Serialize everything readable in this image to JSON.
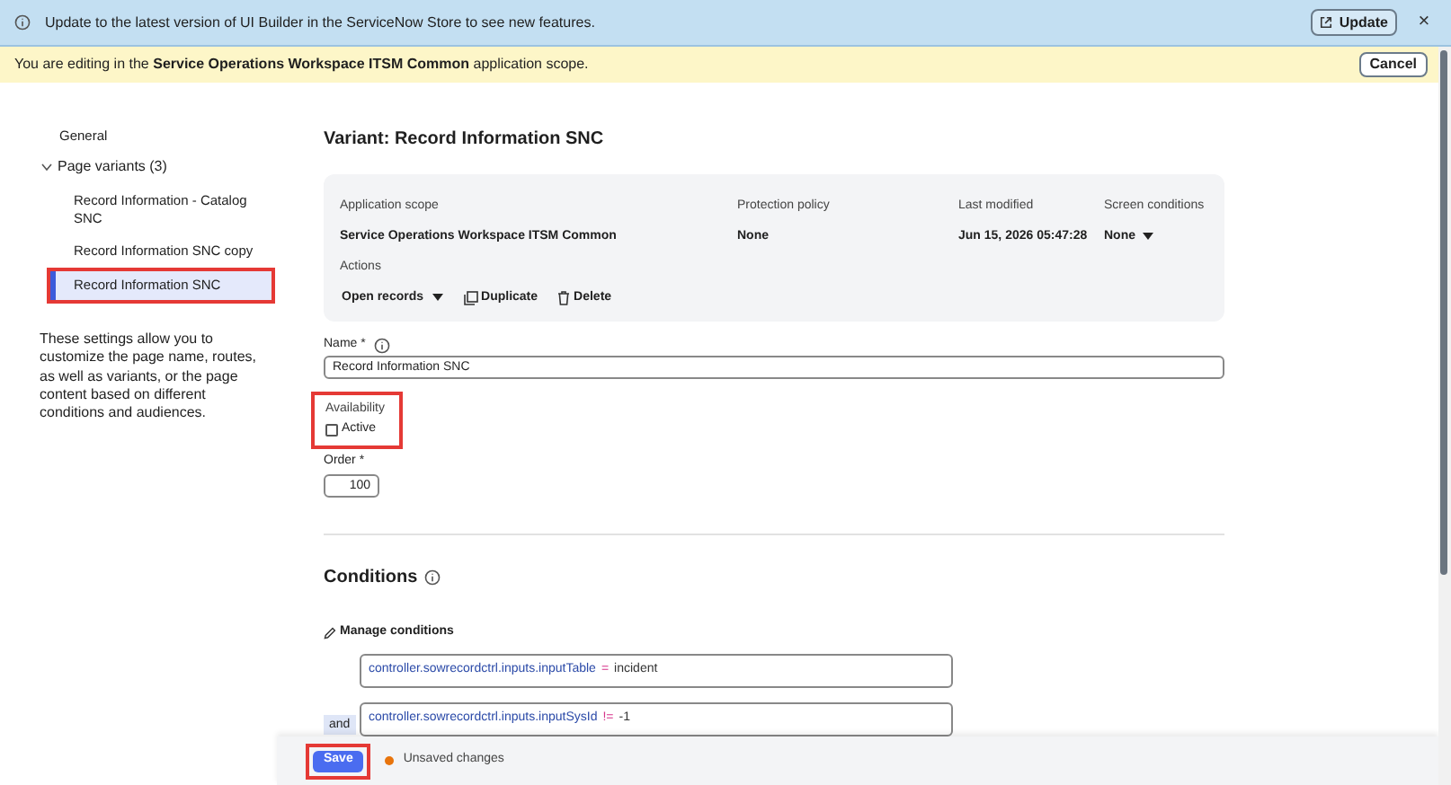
{
  "update_banner": {
    "message": "Update to the latest version of UI Builder in the ServiceNow Store to see new features.",
    "button": "Update",
    "close": "×"
  },
  "scope_banner": {
    "message": "You are editing in the **Service Operations Workspace ITSM Common** application scope.",
    "button": "Cancel"
  },
  "sidebar": {
    "items": [
      {
        "label": "General",
        "selected": false,
        "highlighted": false
      }
    ],
    "group": {
      "label": "Page variants (3)",
      "expanded": true,
      "children": [
        {
          "label": "Record Information - Catalog SNC",
          "selected": false,
          "highlighted": false
        },
        {
          "label": "Record Information SNC copy",
          "selected": false,
          "highlighted": false
        },
        {
          "label": "Record Information SNC",
          "selected": true,
          "highlighted": true
        }
      ]
    },
    "description": "These settings allow you to customize the page name, routes, as well as variants, or the page content based on different conditions and audiences."
  },
  "title": "Variant: Record Information SNC",
  "info_card": {
    "fields": [
      {
        "label": "Application scope",
        "value": "Service Operations Workspace ITSM Common",
        "kind": "text"
      },
      {
        "label": "Protection policy",
        "value": "None",
        "kind": "text"
      },
      {
        "label": "Last modified",
        "value": "Jun 15, 2026 05:47:28",
        "kind": "text"
      },
      {
        "label": "Screen conditions",
        "value": "None",
        "kind": "dropdown"
      }
    ],
    "actions_label": "Actions",
    "actions": [
      {
        "label": "Open records",
        "kind": "dropdown"
      },
      {
        "label": "Duplicate",
        "kind": "duplicate"
      },
      {
        "label": "Delete",
        "kind": "delete"
      }
    ]
  },
  "name_field": {
    "label": "Name",
    "required_mark": "*",
    "value": "Record Information SNC"
  },
  "availability": {
    "label": "Availability",
    "checkbox_label": "Active",
    "checked": false,
    "highlighted": true
  },
  "order_field": {
    "label": "Order",
    "required_mark": "*",
    "value": "100"
  },
  "conditions": {
    "title": "Conditions",
    "manage": "Manage conditions",
    "rows": [
      {
        "connector": "",
        "field": "controller.sowrecordctrl.inputs.inputTable",
        "operator": "=",
        "value": "incident"
      },
      {
        "connector": "and",
        "field": "controller.sowrecordctrl.inputs.inputSysId",
        "operator": "!=",
        "value": "-1"
      }
    ]
  },
  "footer": {
    "save": "Save",
    "save_highlighted": true,
    "status": "Unsaved changes"
  }
}
